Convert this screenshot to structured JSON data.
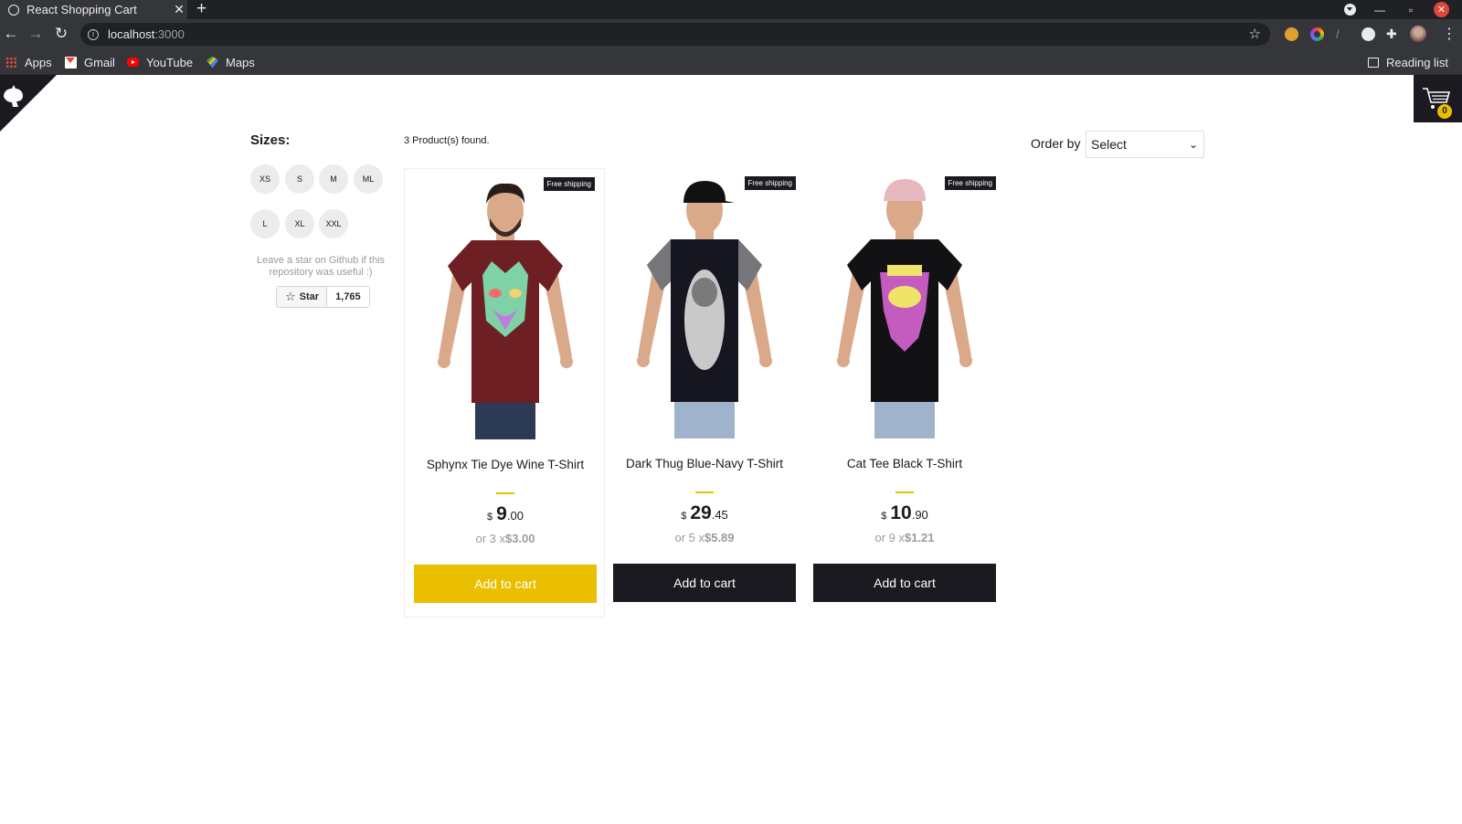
{
  "browser": {
    "tab_title": "React Shopping Cart",
    "tab_close": "✕",
    "new_tab": "+",
    "url_host": "localhost",
    "url_port": ":3000",
    "bookmarks": [
      "Apps",
      "Gmail",
      "YouTube",
      "Maps"
    ],
    "reading_list": "Reading list"
  },
  "header": {
    "cart_count": "0"
  },
  "filters": {
    "title": "Sizes:",
    "sizes": [
      "XS",
      "S",
      "M",
      "ML",
      "L",
      "XL",
      "XXL"
    ]
  },
  "github": {
    "note": "Leave a star on Github if this repository was useful :)",
    "star_label": "Star",
    "star_count": "1,765"
  },
  "shelf": {
    "products_found": "3 Product(s) found.",
    "order_label": "Order by",
    "order_selected": "Select"
  },
  "products": [
    {
      "badge": "Free shipping",
      "title": "Sphynx Tie Dye Wine T-Shirt",
      "currency": "$",
      "price_int": "9",
      "price_dec": ".00",
      "installment_prefix": "or 3 x",
      "installment_value": "$3.00",
      "button": "Add to cart",
      "shirt_color": "#6e1f24",
      "print": "cat"
    },
    {
      "badge": "Free shipping",
      "title": "Dark Thug Blue-Navy T-Shirt",
      "currency": "$",
      "price_int": "29",
      "price_dec": ".45",
      "installment_prefix": "or 5 x",
      "installment_value": "$5.89",
      "button": "Add to cart",
      "shirt_color": "#15161f",
      "print": "thug"
    },
    {
      "badge": "Free shipping",
      "title": "Cat Tee Black T-Shirt",
      "currency": "$",
      "price_int": "10",
      "price_dec": ".90",
      "installment_prefix": "or 9 x",
      "installment_value": "$1.21",
      "button": "Add to cart",
      "shirt_color": "#121214",
      "print": "catguy"
    }
  ]
}
